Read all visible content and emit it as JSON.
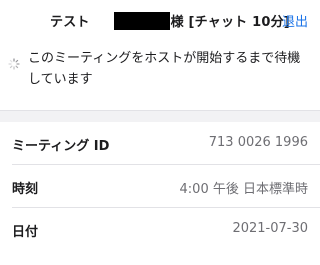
{
  "header": {
    "title_prefix": "テスト",
    "title_suffix": "様 [チャット 10分]",
    "exit_label": "退出"
  },
  "waiting": {
    "message": "このミーティングをホストが開始するまで待機しています",
    "icon": "spinner-icon"
  },
  "info": {
    "rows": [
      {
        "label": "ミーティング ID",
        "value": "713 0026 1996"
      },
      {
        "label": "時刻",
        "value": "4:00 午後 日本標準時"
      },
      {
        "label": "日付",
        "value": "2021-07-30"
      }
    ]
  },
  "colors": {
    "accent": "#1a73e8",
    "separator": "#e2e2e6",
    "gap": "#f2f2f4",
    "value_text": "#6e6e73"
  }
}
